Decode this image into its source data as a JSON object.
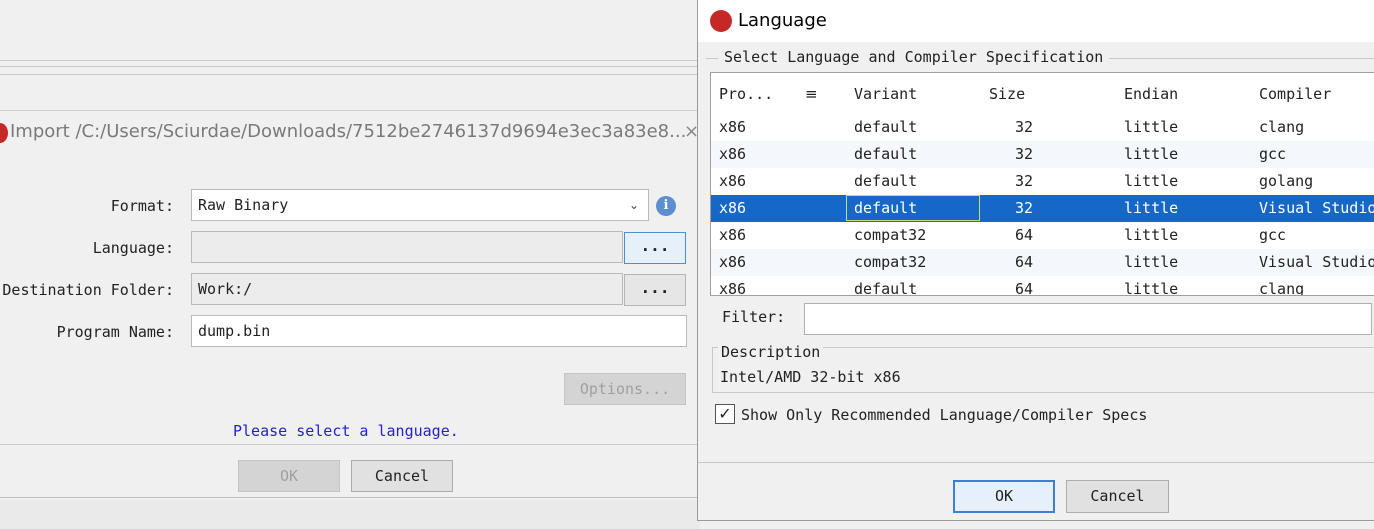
{
  "import_dialog": {
    "title": "Import /C:/Users/Sciurdae/Downloads/7512be2746137d9694e3ec3a83e8...",
    "close": "×",
    "format_label": "Format:",
    "format_value": "Raw Binary",
    "language_label": "Language:",
    "language_value": "",
    "dest_label": "Destination Folder:",
    "dest_value": "Work:/",
    "program_label": "Program Name:",
    "program_value": "dump.bin",
    "browse": "...",
    "options": "Options...",
    "message": "Please select a language.",
    "ok": "OK",
    "cancel": "Cancel",
    "info": "i",
    "dropdown": "⌄"
  },
  "language_dialog": {
    "title": "Language",
    "group_title": "Select Language and Compiler Specification",
    "columns": [
      "Pro...",
      "Variant",
      "Size",
      "Endian",
      "Compiler"
    ],
    "sort_icon": "≡",
    "rows": [
      {
        "processor": "x86",
        "variant": "default",
        "size": "32",
        "endian": "little",
        "compiler": "clang"
      },
      {
        "processor": "x86",
        "variant": "default",
        "size": "32",
        "endian": "little",
        "compiler": "gcc"
      },
      {
        "processor": "x86",
        "variant": "default",
        "size": "32",
        "endian": "little",
        "compiler": "golang"
      },
      {
        "processor": "x86",
        "variant": "default",
        "size": "32",
        "endian": "little",
        "compiler": "Visual Studio"
      },
      {
        "processor": "x86",
        "variant": "compat32",
        "size": "64",
        "endian": "little",
        "compiler": "gcc"
      },
      {
        "processor": "x86",
        "variant": "compat32",
        "size": "64",
        "endian": "little",
        "compiler": "Visual Studio"
      },
      {
        "processor": "x86",
        "variant": "default",
        "size": "64",
        "endian": "little",
        "compiler": "clang"
      }
    ],
    "selected_row": 3,
    "filter_label": "Filter:",
    "filter_value": "",
    "description_label": "Description",
    "description_text": "Intel/AMD 32-bit x86",
    "checkbox_label": "Show Only Recommended Language/Compiler Specs",
    "checkbox_checked": true,
    "check_mark": "✓",
    "ok": "OK",
    "cancel": "Cancel"
  }
}
